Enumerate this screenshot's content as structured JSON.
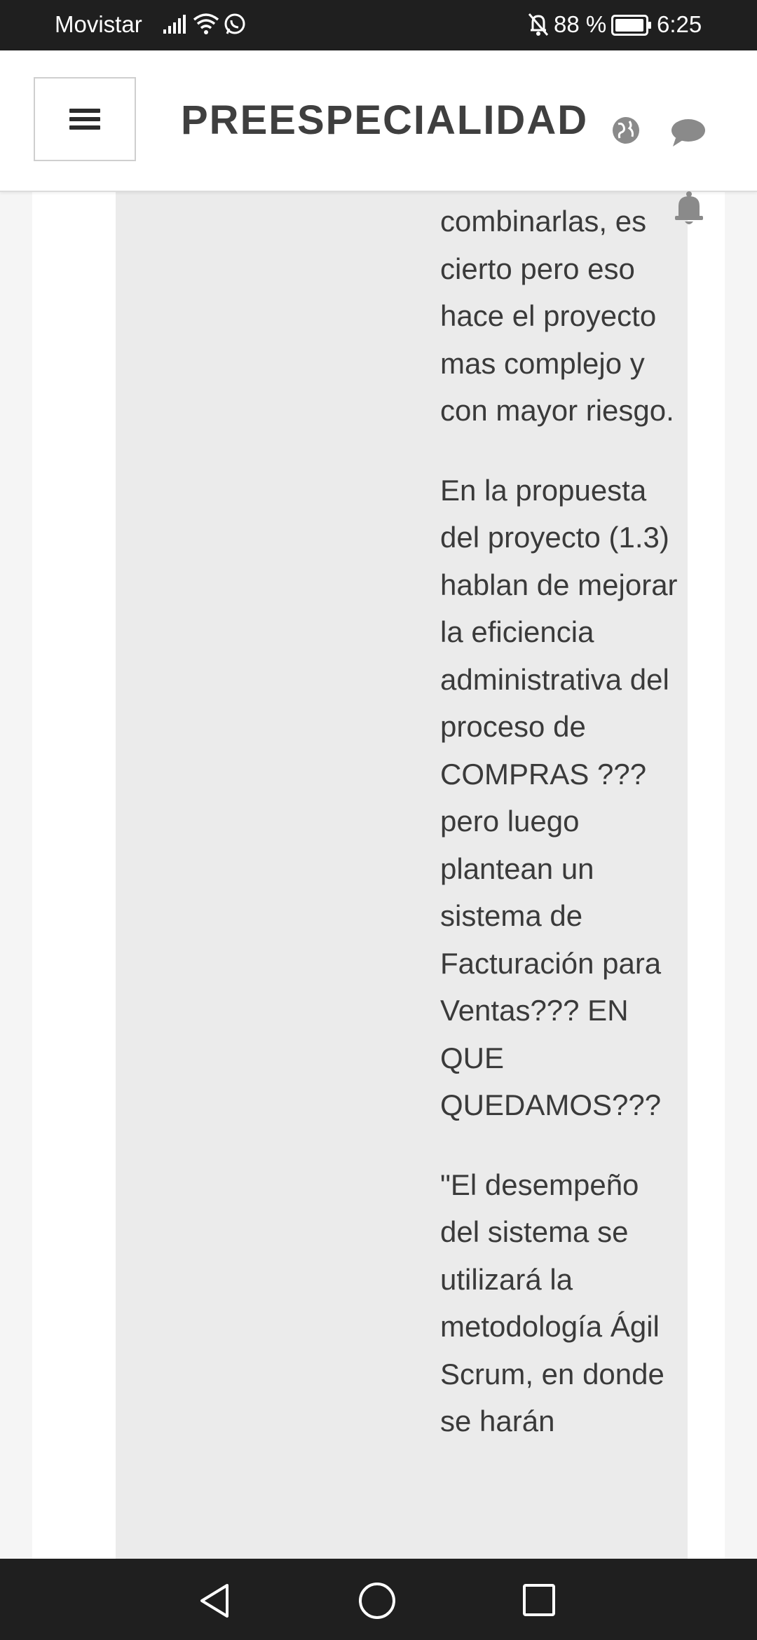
{
  "status_bar": {
    "carrier": "Movistar",
    "battery_percent": "88 %",
    "time": "6:25",
    "icons": [
      "signal-icon",
      "wifi-icon",
      "whatsapp-icon",
      "mute-bell-icon",
      "battery-icon"
    ]
  },
  "header": {
    "title": "PREESPECIALIDAD",
    "icons": [
      "menu-icon",
      "globe-icon",
      "chat-icon",
      "bell-icon"
    ]
  },
  "post": {
    "paragraphs": [
      "combinarlas, es cierto pero eso hace el proyecto mas complejo y con mayor riesgo.",
      "En la propuesta del proyecto (1.3) hablan de mejorar la eficiencia administrativa del proceso de COMPRAS ??? pero luego plantean un sistema de Facturación para Ventas??? EN QUE QUEDAMOS???",
      "\"El desempeño del sistema se utilizará la metodología Ágil Scrum, en donde se harán"
    ]
  },
  "nav_bar": {
    "icons": [
      "back-icon",
      "home-icon",
      "recent-apps-icon"
    ]
  },
  "colors": {
    "status_bar_bg": "#1f1f1f",
    "header_bg": "#ffffff",
    "panel_bg": "#ebebeb",
    "text": "#3a3a3a"
  }
}
